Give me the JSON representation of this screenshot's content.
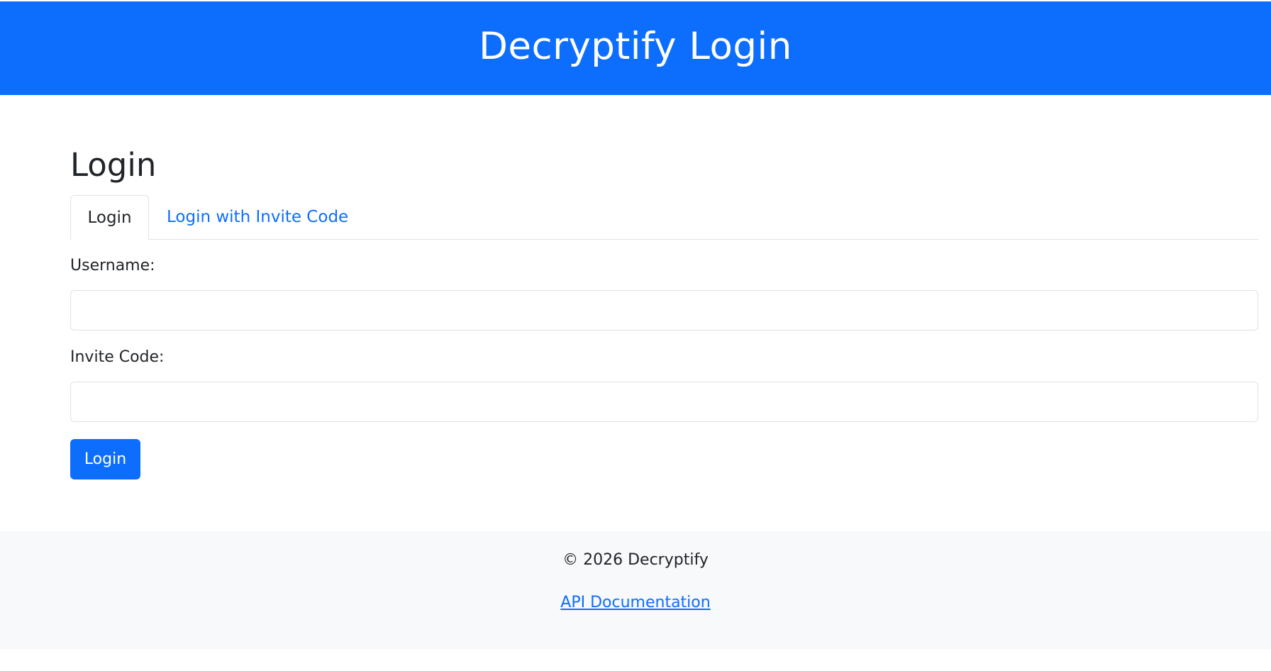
{
  "header": {
    "title": "Decryptify Login"
  },
  "main": {
    "page_title": "Login",
    "tabs": [
      {
        "label": "Login",
        "active": true
      },
      {
        "label": "Login with Invite Code",
        "active": false
      }
    ],
    "form": {
      "username_label": "Username:",
      "username_value": "",
      "invite_code_label": "Invite Code:",
      "invite_code_value": "",
      "submit_label": "Login"
    }
  },
  "footer": {
    "copyright": "© 2026 Decryptify",
    "api_link": "API Documentation"
  },
  "colors": {
    "primary": "#0d6efd",
    "footer_bg": "#f8f9fa",
    "border": "#dee2e6",
    "text": "#212529"
  }
}
